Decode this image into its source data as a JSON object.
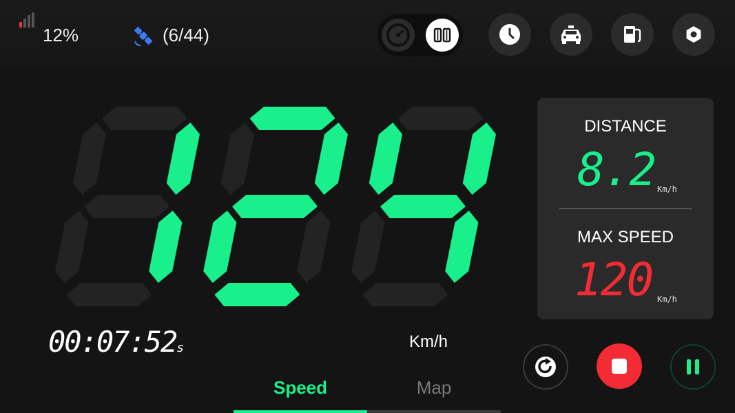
{
  "status": {
    "battery_text": "12%",
    "satellite_text": "(6/44)",
    "signal_color": "#e53935",
    "satellite_color": "#3d7bf2"
  },
  "mode_toggle": {
    "options": [
      "gauge-icon",
      "digital-icon"
    ],
    "selected": "digital-icon"
  },
  "top_buttons": [
    "history-icon",
    "car-icon",
    "fuel-icon",
    "settings-icon"
  ],
  "speed": {
    "value": "124",
    "unit": "Km/h",
    "color": "#19f08b"
  },
  "timer": {
    "value": "00:07:52",
    "unit": "s"
  },
  "stats": {
    "distance_label": "DISTANCE",
    "distance_value": "8.2",
    "distance_unit": "Km/h",
    "distance_color": "#19f08b",
    "max_speed_label": "MAX SPEED",
    "max_speed_value": "120",
    "max_speed_unit": "Km/h",
    "max_speed_color": "#f22b34"
  },
  "tabs": [
    {
      "label": "Speed",
      "active": true
    },
    {
      "label": "Map",
      "active": false
    }
  ],
  "controls": [
    "reset-icon",
    "stop-icon",
    "pause-icon"
  ]
}
